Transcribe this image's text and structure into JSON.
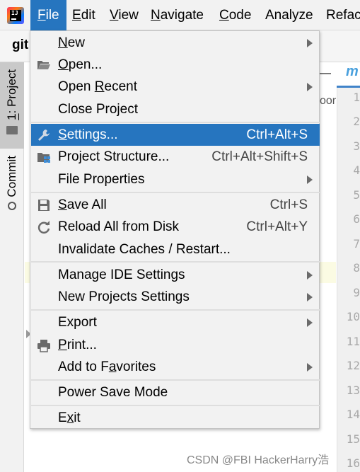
{
  "menubar": {
    "logo_icon": "intellij-idea-logo-icon",
    "items": [
      {
        "label": "File",
        "mnemonic": "F",
        "rest": "ile",
        "active": true
      },
      {
        "label": "Edit",
        "mnemonic": "E",
        "rest": "dit"
      },
      {
        "label": "View",
        "mnemonic": "V",
        "rest": "iew"
      },
      {
        "label": "Navigate",
        "mnemonic": "N",
        "rest": "avigate"
      },
      {
        "label": "Code",
        "mnemonic": "C",
        "rest": "ode"
      },
      {
        "label": "Analyze",
        "mnemonic": "",
        "rest": "Analyze"
      },
      {
        "label": "Refac",
        "mnemonic": "",
        "rest": "Refac"
      }
    ]
  },
  "toolbar": {
    "project_name": "git"
  },
  "left_tabs": {
    "project": {
      "number": "1",
      "label": ": Project"
    },
    "commit": {
      "label": "Commit"
    }
  },
  "project_panel": {
    "tail_text": "oor"
  },
  "editor": {
    "tab_text": "m",
    "line_numbers": [
      "1",
      "2",
      "3",
      "4",
      "5",
      "6",
      "7",
      "8",
      "9",
      "10",
      "11",
      "12",
      "13",
      "14",
      "15",
      "16"
    ]
  },
  "file_menu": {
    "items": [
      {
        "pre": "",
        "mn": "N",
        "post": "ew",
        "shortcut": "",
        "submenu": true,
        "icon": ""
      },
      {
        "pre": "",
        "mn": "O",
        "post": "pen...",
        "shortcut": "",
        "submenu": false,
        "icon": "open-folder-icon"
      },
      {
        "pre": "Open ",
        "mn": "R",
        "post": "ecent",
        "shortcut": "",
        "submenu": true,
        "icon": ""
      },
      {
        "pre": "Close Project",
        "mn": "",
        "post": "",
        "shortcut": "",
        "submenu": false,
        "icon": ""
      },
      {
        "pre": "",
        "mn": "S",
        "post": "ettings...",
        "shortcut": "Ctrl+Alt+S",
        "submenu": false,
        "icon": "wrench-icon",
        "selected": true
      },
      {
        "pre": "Project Structure...",
        "mn": "",
        "post": "",
        "shortcut": "Ctrl+Alt+Shift+S",
        "submenu": false,
        "icon": "project-structure-icon"
      },
      {
        "pre": "File Properties",
        "mn": "",
        "post": "",
        "shortcut": "",
        "submenu": true,
        "icon": ""
      },
      {
        "pre": "",
        "mn": "S",
        "post": "ave All",
        "shortcut": "Ctrl+S",
        "submenu": false,
        "icon": "save-icon"
      },
      {
        "pre": "Reload All from Disk",
        "mn": "",
        "post": "",
        "shortcut": "Ctrl+Alt+Y",
        "submenu": false,
        "icon": "reload-icon"
      },
      {
        "pre": "Invalidate Caches / Restart...",
        "mn": "",
        "post": "",
        "shortcut": "",
        "submenu": false,
        "icon": ""
      },
      {
        "pre": "Manage IDE Settings",
        "mn": "",
        "post": "",
        "shortcut": "",
        "submenu": true,
        "icon": ""
      },
      {
        "pre": "New Projects Settings",
        "mn": "",
        "post": "",
        "shortcut": "",
        "submenu": true,
        "icon": ""
      },
      {
        "pre": "Export",
        "mn": "",
        "post": "",
        "shortcut": "",
        "submenu": true,
        "icon": ""
      },
      {
        "pre": "",
        "mn": "P",
        "post": "rint...",
        "shortcut": "",
        "submenu": false,
        "icon": "print-icon"
      },
      {
        "pre": "Add to F",
        "mn": "a",
        "post": "vorites",
        "shortcut": "",
        "submenu": true,
        "icon": ""
      },
      {
        "pre": "Power Save Mode",
        "mn": "",
        "post": "",
        "shortcut": "",
        "submenu": false,
        "icon": ""
      },
      {
        "pre": "E",
        "mn": "x",
        "post": "it",
        "shortcut": "",
        "submenu": false,
        "icon": ""
      }
    ]
  },
  "watermark": "CSDN @FBI HackerHarry浩",
  "colors": {
    "selection": "#2675bf",
    "menu_bg": "#f2f2f2",
    "accent_tab": "#4083c9"
  }
}
